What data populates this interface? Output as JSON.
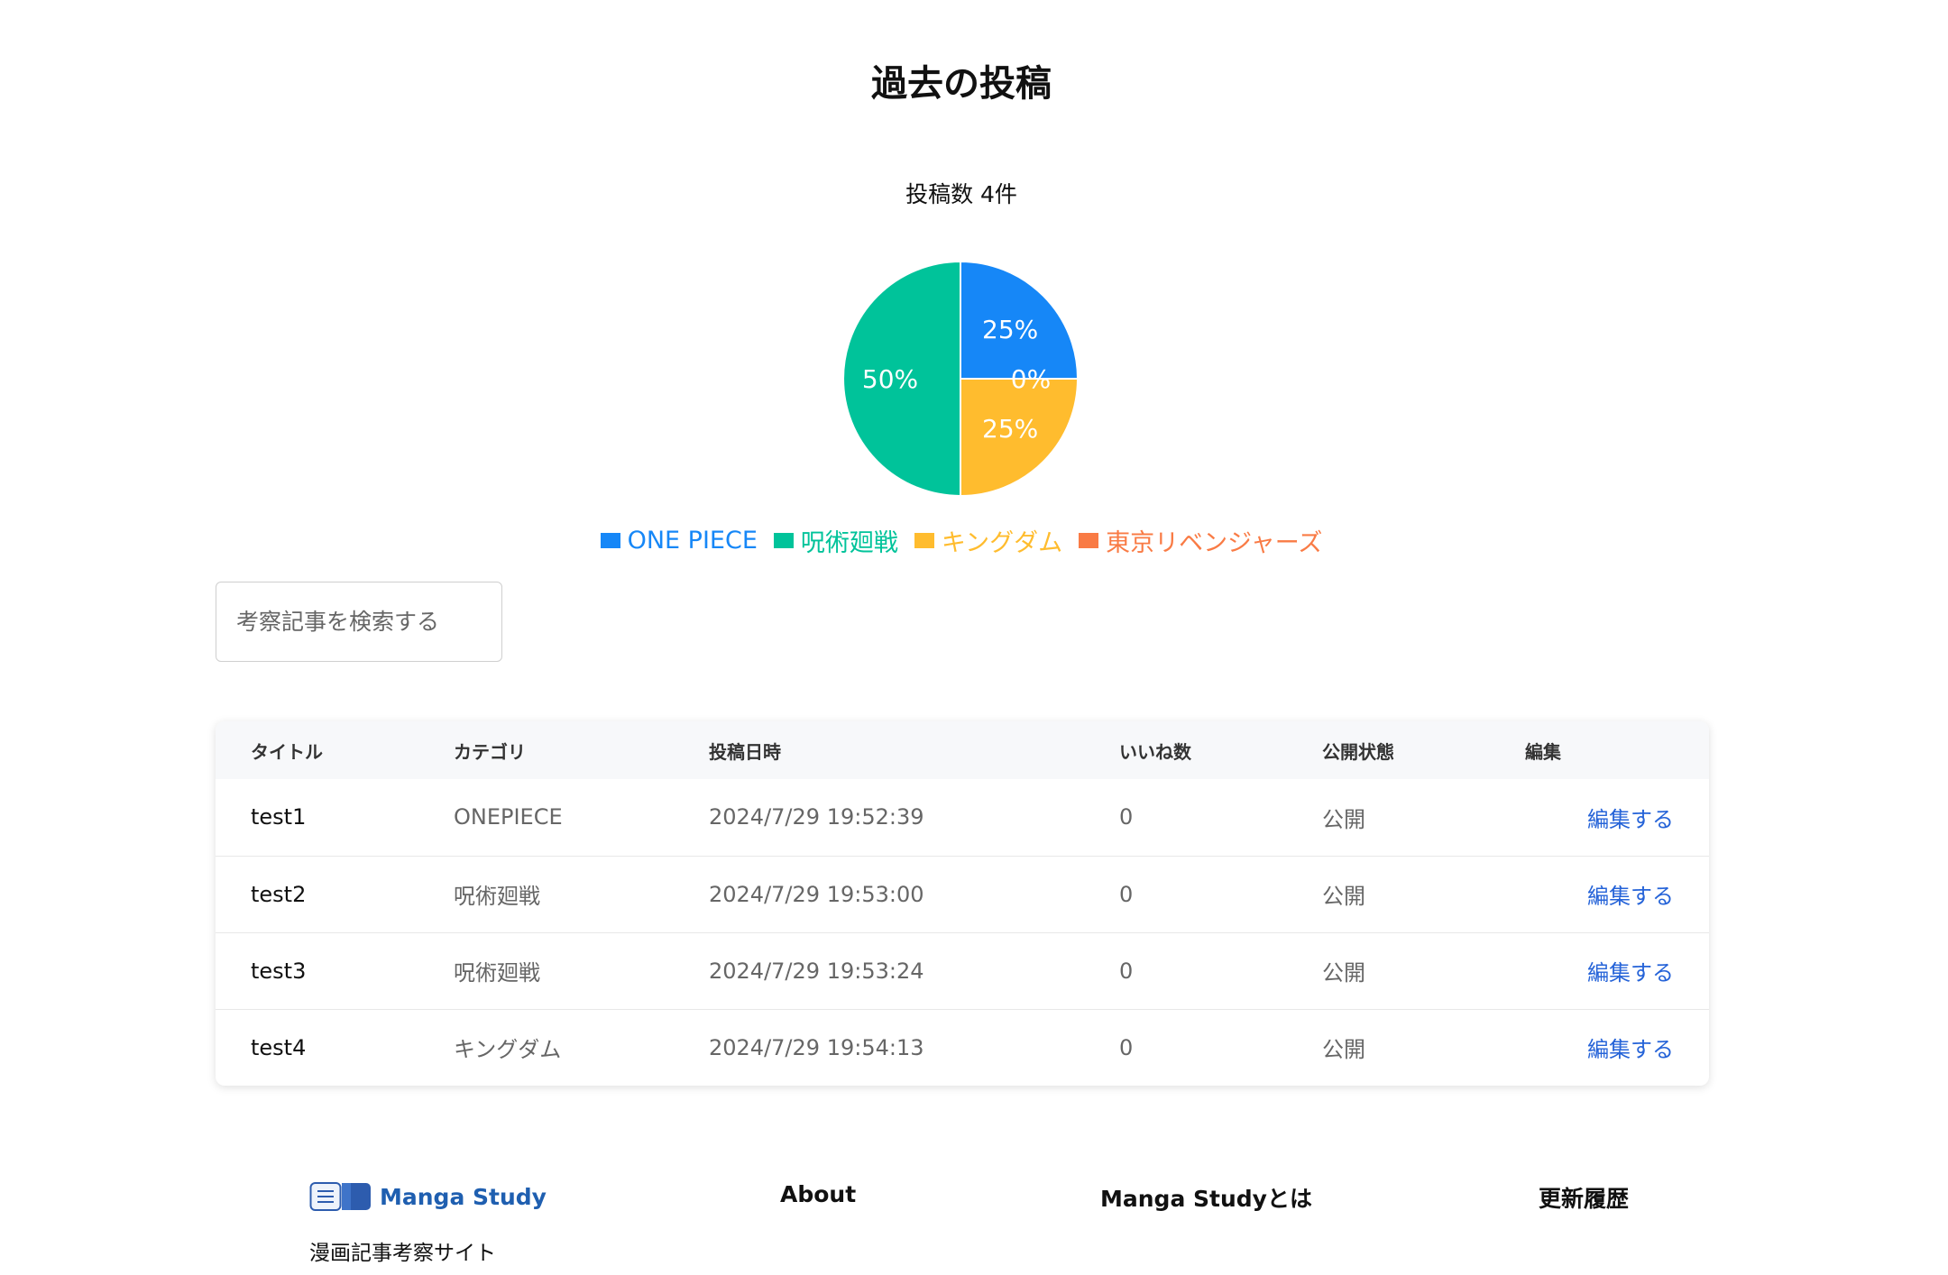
{
  "page": {
    "title": "過去の投稿"
  },
  "chart_data": {
    "type": "pie",
    "title": "投稿数 4件",
    "categories": [
      "ONE PIECE",
      "呪術廻戦",
      "キングダム",
      "東京リベンジャーズ"
    ],
    "values": [
      1,
      2,
      1,
      0
    ],
    "percent_labels": [
      "25%",
      "50%",
      "25%",
      "0%"
    ],
    "colors": [
      "#1687f7",
      "#00c39a",
      "#ffbc2e",
      "#f97b45"
    ],
    "legend_position": "bottom"
  },
  "search": {
    "placeholder": "考察記事を検索する"
  },
  "table": {
    "headers": [
      "タイトル",
      "カテゴリ",
      "投稿日時",
      "いいね数",
      "公開状態",
      "編集"
    ],
    "rows": [
      {
        "title": "test1",
        "category": "ONEPIECE",
        "date": "2024/7/29 19:52:39",
        "likes": "0",
        "status": "公開",
        "edit": "編集する"
      },
      {
        "title": "test2",
        "category": "呪術廻戦",
        "date": "2024/7/29 19:53:00",
        "likes": "0",
        "status": "公開",
        "edit": "編集する"
      },
      {
        "title": "test3",
        "category": "呪術廻戦",
        "date": "2024/7/29 19:53:24",
        "likes": "0",
        "status": "公開",
        "edit": "編集する"
      },
      {
        "title": "test4",
        "category": "キングダム",
        "date": "2024/7/29 19:54:13",
        "likes": "0",
        "status": "公開",
        "edit": "編集する"
      }
    ]
  },
  "footer": {
    "logo_text": "Manga Study",
    "tagline": "漫画記事考察サイト",
    "links": [
      "About",
      "Manga Studyとは",
      "更新履歴"
    ],
    "brand_color": "#1f5fb0"
  }
}
